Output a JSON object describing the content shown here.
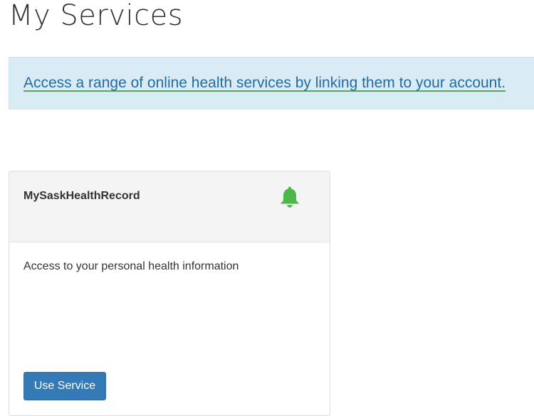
{
  "page": {
    "title": "My Services"
  },
  "banner": {
    "link_text": "Access a range of online health services by linking them to your account."
  },
  "service_card": {
    "title": "MySaskHealthRecord",
    "icon": "bell-icon",
    "icon_color": "#4db748",
    "description": "Access to your personal health information",
    "button_label": "Use Service",
    "button_color": "#337ab7"
  },
  "colors": {
    "banner_background": "#d9ecf5",
    "link_color": "#256b9e",
    "link_underline": "#4caf50",
    "card_header_background": "#f4f4f4"
  }
}
